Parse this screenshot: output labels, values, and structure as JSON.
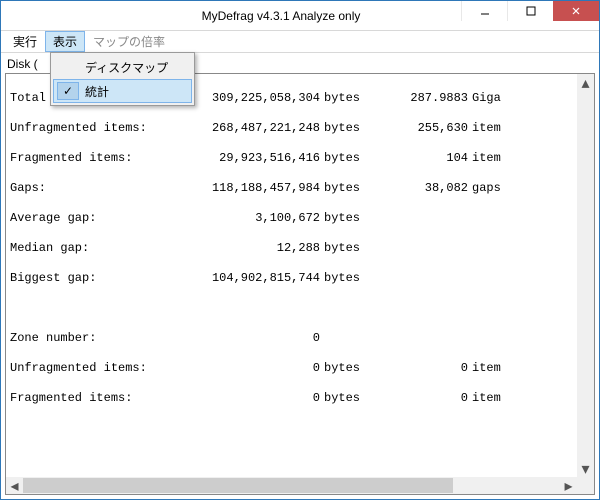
{
  "window": {
    "title": "MyDefrag v4.3.1    Analyze only"
  },
  "menu": {
    "run": "実行",
    "view": "表示",
    "scale": "マップの倍率"
  },
  "dropdown": {
    "diskmap": "ディスクマップ",
    "stats": "統計",
    "check": "✓"
  },
  "label": "Disk (",
  "stats": {
    "total_disk_space": {
      "label": "Total disk space:",
      "bytes": "309,225,058,304",
      "unit": "bytes",
      "rv": "287.9883",
      "ru": "Giga"
    },
    "unfragmented_items": {
      "label": "Unfragmented items:",
      "bytes": "268,487,221,248",
      "unit": "bytes",
      "rv": "255,630",
      "ru": "item"
    },
    "fragmented_items": {
      "label": "Fragmented items:",
      "bytes": "29,923,516,416",
      "unit": "bytes",
      "rv": "104",
      "ru": "item"
    },
    "gaps": {
      "label": "Gaps:",
      "bytes": "118,188,457,984",
      "unit": "bytes",
      "rv": "38,082",
      "ru": "gaps"
    },
    "average_gap": {
      "label": "Average gap:",
      "bytes": "3,100,672",
      "unit": "bytes"
    },
    "median_gap": {
      "label": "Median gap:",
      "bytes": "12,288",
      "unit": "bytes"
    },
    "biggest_gap": {
      "label": "Biggest gap:",
      "bytes": "104,902,815,744",
      "unit": "bytes"
    },
    "zone_number": {
      "label": "Zone number:",
      "bytes": "0"
    },
    "z_unfrag": {
      "label": "Unfragmented items:",
      "bytes": "0",
      "unit": "bytes",
      "rv": "0",
      "ru": "item"
    },
    "z_frag": {
      "label": "Fragmented items:",
      "bytes": "0",
      "unit": "bytes",
      "rv": "0",
      "ru": "item"
    }
  }
}
